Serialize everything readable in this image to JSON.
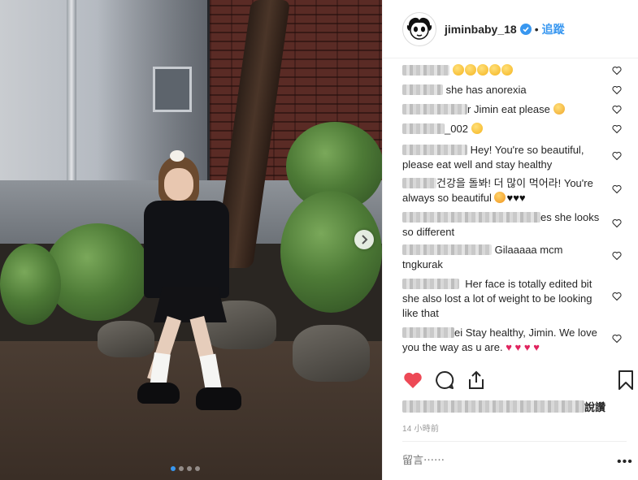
{
  "post": {
    "carousel_slide": 1,
    "carousel_total": 4
  },
  "header": {
    "username": "jiminbaby_18",
    "separator": "•",
    "follow_label": "追蹤",
    "avatar_icon": "betty-boop-avatar-icon",
    "verified_icon": "verified-badge-icon"
  },
  "comments": [
    {
      "user": "",
      "text": "",
      "emojis": [
        "sad-emoji",
        "sad-emoji",
        "sad-emoji",
        "sad-emoji",
        "sad-emoji"
      ]
    },
    {
      "user": "",
      "text": "she has anorexia"
    },
    {
      "user": "",
      "text": "r Jimin eat please",
      "emojis": [
        "worried-emoji"
      ]
    },
    {
      "user": "",
      "text": "_002",
      "emojis": [
        "sad-emoji"
      ]
    },
    {
      "user": "",
      "text": "Hey! You're so beautiful, please eat well and stay healthy"
    },
    {
      "user": "",
      "text": "건강을 돌봐! 더 많이 먹어라! You're always so beautiful",
      "emojis": [
        "kissing-emoji"
      ],
      "hearts": "♥♥♥"
    },
    {
      "user": "",
      "text": "es she looks so different"
    },
    {
      "user": "",
      "text": "Gilaaaaa mcm tngkurak"
    },
    {
      "user": "",
      "text": "Her face is totally edited bit she also lost a lot of weight to be looking like that"
    },
    {
      "user": "",
      "text": "ei Stay healthy, Jimin. We love you the way as u are.",
      "hearts": "♥ ♥ ♥ ♥"
    }
  ],
  "footer": {
    "likes_suffix": "說讚",
    "timestamp": "14 小時前",
    "comment_placeholder": "留言⋯⋯",
    "more_label": "•••"
  },
  "colors": {
    "accent": "#3897f0",
    "like_red": "#ed4956",
    "text": "#262626",
    "muted": "#999999"
  }
}
